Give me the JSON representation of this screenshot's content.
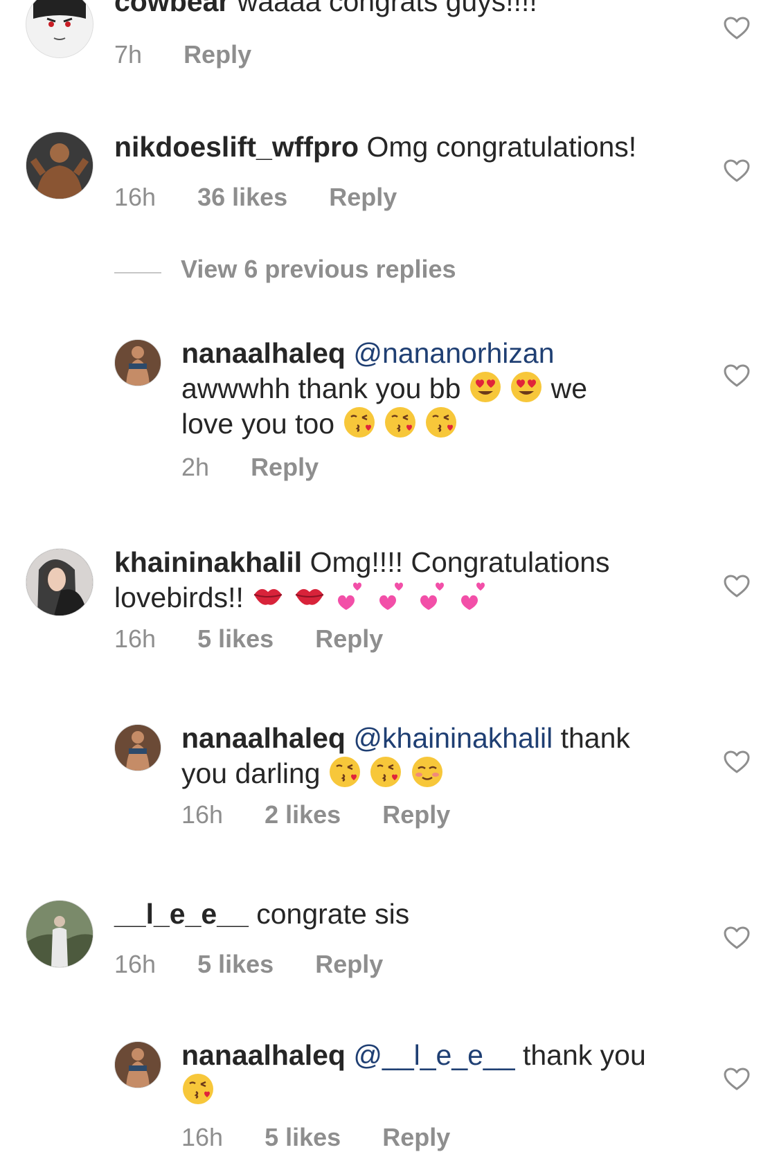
{
  "comments": [
    {
      "user": "cowbear",
      "text": "waaaa congrats guys!!!!",
      "time": "7h",
      "likes": "",
      "reply": "Reply"
    },
    {
      "user": "nikdoeslift_wffpro",
      "text": "Omg congratulations!",
      "time": "16h",
      "likes": "36 likes",
      "reply": "Reply"
    },
    {
      "user": "nanaalhaleq",
      "mention": "@nananorhizan",
      "text_a": "awwwhh thank you bb",
      "text_b": "we",
      "text_c": "love you too",
      "time": "2h",
      "reply": "Reply"
    },
    {
      "user": "khaininakhalil",
      "text_a": "Omg!!!! Congratulations",
      "text_b": "lovebirds!!",
      "time": "16h",
      "likes": "5 likes",
      "reply": "Reply"
    },
    {
      "user": "nanaalhaleq",
      "mention": "@khaininakhalil",
      "text_a": "thank",
      "text_b": "you darling",
      "time": "16h",
      "likes": "2 likes",
      "reply": "Reply"
    },
    {
      "user": "__l_e_e__",
      "text": "congrate sis",
      "time": "16h",
      "likes": "5 likes",
      "reply": "Reply"
    },
    {
      "user": "nanaalhaleq",
      "mention": "@__l_e_e__",
      "text_a": "thank you",
      "time": "16h",
      "likes": "5 likes",
      "reply": "Reply"
    }
  ],
  "view_replies": "View 6 previous replies"
}
